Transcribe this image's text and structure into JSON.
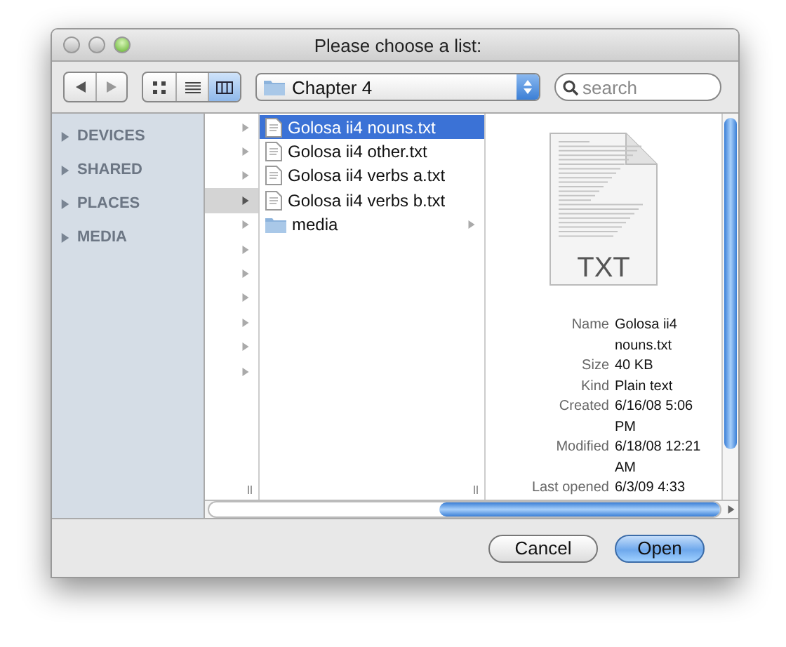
{
  "window": {
    "title": "Please choose a list:"
  },
  "toolbar": {
    "location": "Chapter 4",
    "search": {
      "placeholder": "search"
    },
    "views": [
      {
        "kind": "icons",
        "selected": false
      },
      {
        "kind": "list",
        "selected": false
      },
      {
        "kind": "columns",
        "selected": true
      }
    ]
  },
  "sidebar": {
    "sections": [
      {
        "label": "DEVICES",
        "expanded": false
      },
      {
        "label": "SHARED",
        "expanded": false
      },
      {
        "label": "PLACES",
        "expanded": false
      },
      {
        "label": "MEDIA",
        "expanded": false
      }
    ]
  },
  "column_1": {
    "rows": [
      {
        "selected": false
      },
      {
        "selected": false
      },
      {
        "selected": false
      },
      {
        "selected": true
      },
      {
        "selected": false
      },
      {
        "selected": false
      },
      {
        "selected": false
      },
      {
        "selected": false
      },
      {
        "selected": false
      },
      {
        "selected": false
      },
      {
        "selected": false
      }
    ]
  },
  "column_2": {
    "items": [
      {
        "name": "Golosa ii4 nouns.txt",
        "kind": "file",
        "selected": true
      },
      {
        "name": "Golosa ii4 other.txt",
        "kind": "file",
        "selected": false
      },
      {
        "name": "Golosa ii4 verbs a.txt",
        "kind": "file",
        "selected": false
      },
      {
        "name": "Golosa ii4 verbs b.txt",
        "kind": "file",
        "selected": false
      },
      {
        "name": "media",
        "kind": "folder",
        "selected": false
      }
    ]
  },
  "preview": {
    "icon_label": "TXT",
    "info": [
      {
        "label": "Name",
        "value": "Golosa ii4 nouns.txt"
      },
      {
        "label": "Size",
        "value": "40 KB"
      },
      {
        "label": "Kind",
        "value": "Plain text"
      },
      {
        "label": "Created",
        "value": "6/16/08 5:06 PM"
      },
      {
        "label": "Modified",
        "value": "6/18/08 12:21 AM"
      },
      {
        "label": "Last opened",
        "value": "6/3/09 4:33"
      }
    ]
  },
  "buttons": [
    {
      "label": "Cancel",
      "kind": "secondary"
    },
    {
      "label": "Open",
      "kind": "default"
    }
  ]
}
